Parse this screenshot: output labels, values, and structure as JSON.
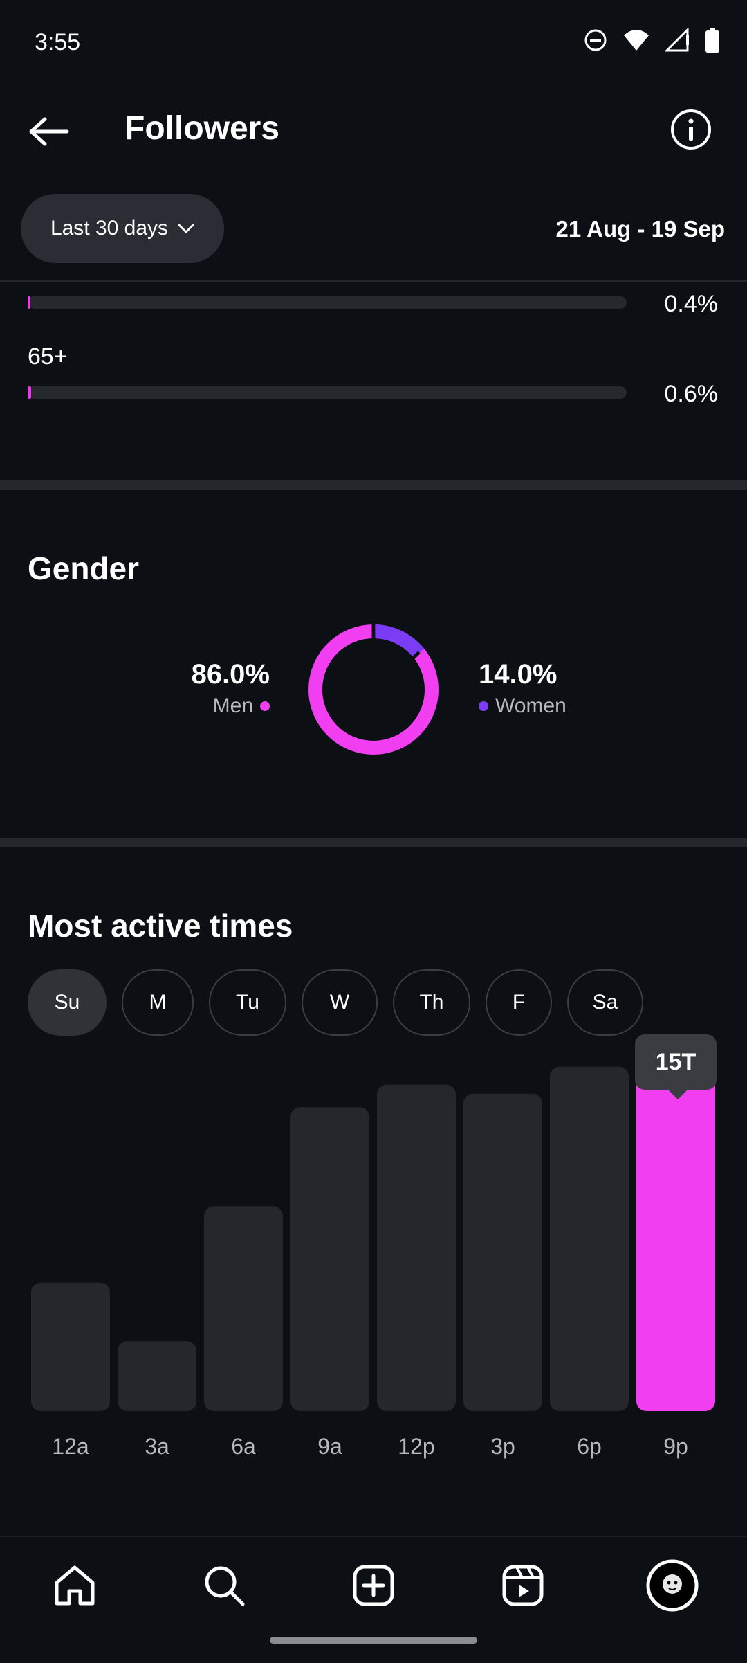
{
  "status_bar": {
    "time": "3:55"
  },
  "header": {
    "title": "Followers"
  },
  "filters": {
    "range_label": "Last 30 days",
    "date_range": "21 Aug - 19 Sep"
  },
  "age": {
    "rows": [
      {
        "label": "",
        "percent": 0.4,
        "percent_label": "0.4%"
      },
      {
        "label": "65+",
        "percent": 0.6,
        "percent_label": "0.6%"
      }
    ]
  },
  "gender": {
    "title": "Gender",
    "men": {
      "percent_label": "86.0%",
      "label": "Men",
      "value": 86.0,
      "color": "#f13ef0"
    },
    "women": {
      "percent_label": "14.0%",
      "label": "Women",
      "value": 14.0,
      "color": "#7b3cf5"
    }
  },
  "active_times": {
    "title": "Most active times",
    "days": [
      "Su",
      "M",
      "Tu",
      "W",
      "Th",
      "F",
      "Sa"
    ],
    "selected_day": "Su",
    "tooltip": "15T"
  },
  "chart_data": {
    "type": "bar",
    "categories": [
      "12a",
      "3a",
      "6a",
      "9a",
      "12p",
      "3p",
      "6p",
      "9p"
    ],
    "values": [
      5.7,
      3.1,
      9.1,
      13.5,
      14.5,
      14.1,
      15.3,
      15.0
    ],
    "highlighted_index": 7,
    "ylim": [
      0,
      16
    ],
    "colors": {
      "bar": "#25272c",
      "highlight": "#f13ef0"
    }
  },
  "nav": {
    "icons": [
      "home-icon",
      "search-icon",
      "create-icon",
      "reels-icon",
      "profile-avatar"
    ]
  }
}
